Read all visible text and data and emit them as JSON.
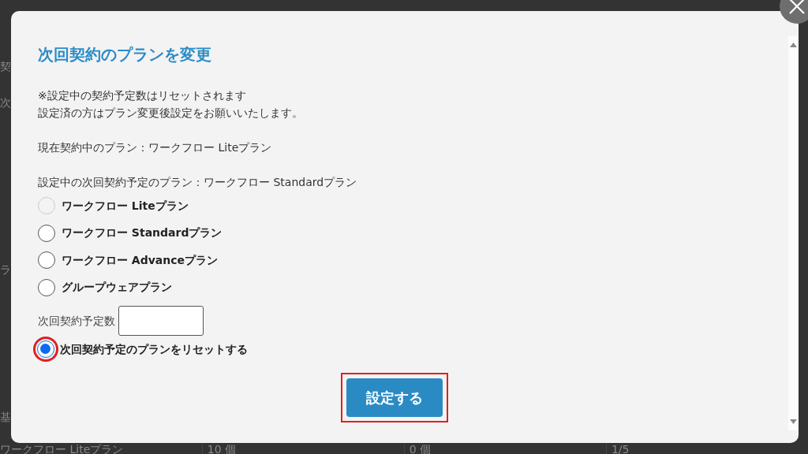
{
  "background": {
    "fragments": [
      "契",
      "次",
      "ラ",
      "基"
    ],
    "last_row": [
      "ワークフロー Liteプラン",
      "10 個",
      "0 個",
      "1/5"
    ]
  },
  "dialog": {
    "title": "次回契約のプランを変更",
    "notes": [
      "※設定中の契約予定数はリセットされます",
      "設定済の方はプラン変更後設定をお願いいたします。"
    ],
    "current_plan": "現在契約中のプラン：ワークフロー Liteプラン",
    "scheduled_plan": "設定中の次回契約予定のプラン：ワークフロー Standardプラン",
    "options": [
      {
        "label": "ワークフロー Liteプラン",
        "selected": false,
        "disabled": true
      },
      {
        "label": "ワークフロー Standardプラン",
        "selected": false,
        "disabled": false
      },
      {
        "label": "ワークフロー Advanceプラン",
        "selected": false,
        "disabled": false
      },
      {
        "label": "グループウェアプラン",
        "selected": false,
        "disabled": false
      }
    ],
    "count_label": "次回契約予定数",
    "reset_option": {
      "label": "次回契約予定のプランをリセットする",
      "selected": true,
      "highlighted": true
    },
    "submit": {
      "label": "設定する",
      "highlighted": true
    }
  }
}
